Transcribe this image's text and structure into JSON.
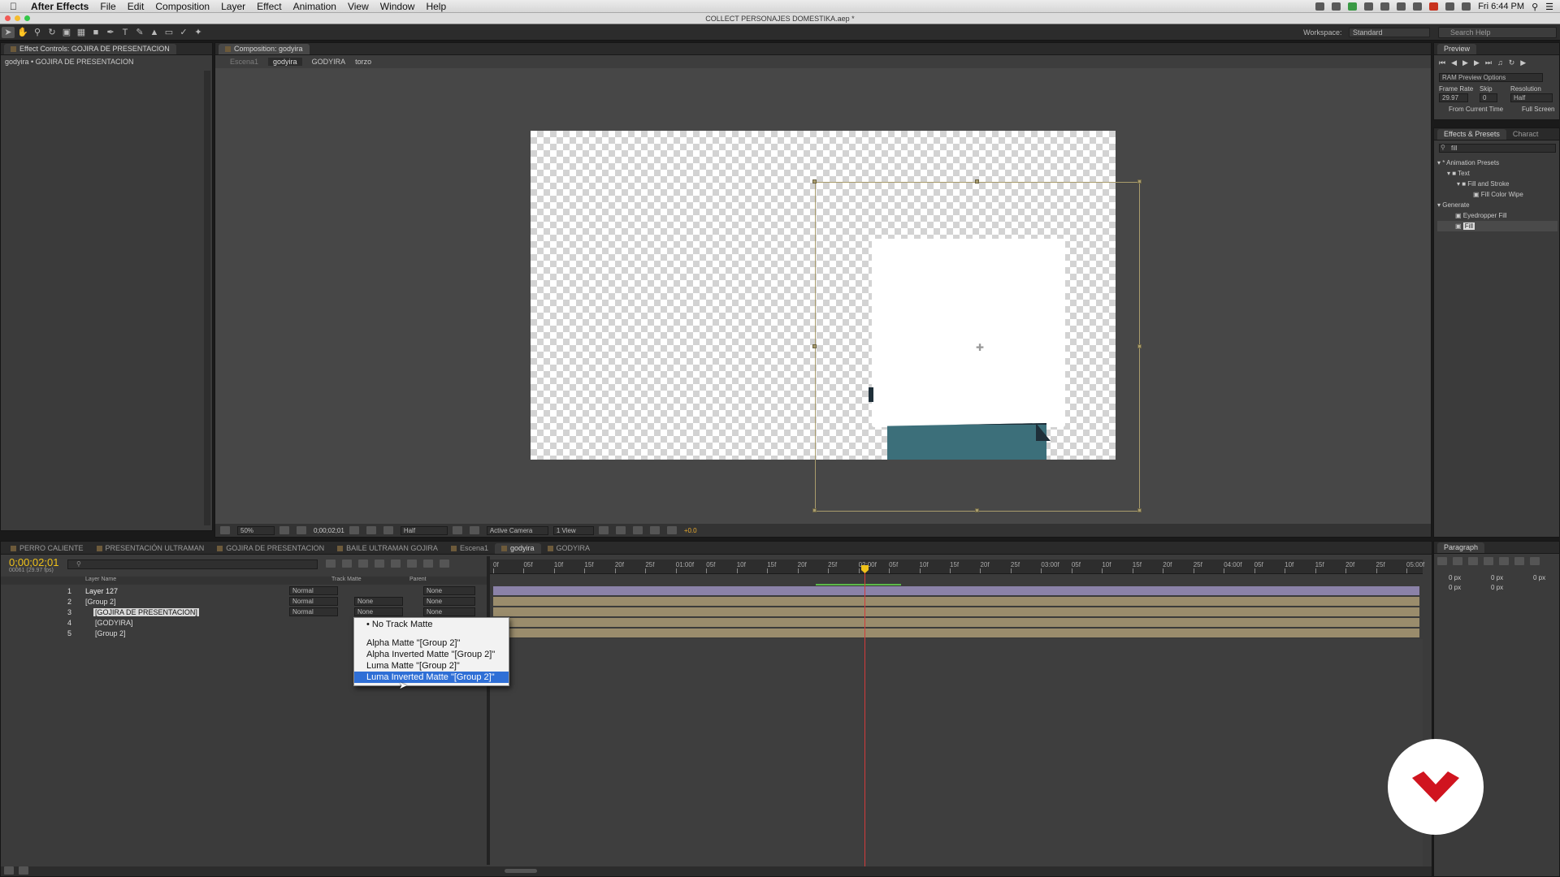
{
  "menubar": {
    "app_name": "After Effects",
    "items": [
      "File",
      "Edit",
      "Composition",
      "Layer",
      "Effect",
      "Animation",
      "View",
      "Window",
      "Help"
    ],
    "clock": "Fri 6:44 PM"
  },
  "titlebar": {
    "title": "COLLECT PERSONAJES DOMESTIKA.aep *"
  },
  "toolbar": {
    "workspace_label": "Workspace:",
    "workspace_value": "Standard",
    "search_placeholder": "Search Help"
  },
  "effect_controls": {
    "tab_label": "Effect Controls: GOJIRA DE PRESENTACION",
    "path": "godyira • GOJIRA DE PRESENTACION"
  },
  "composition": {
    "tab_label": "Composition: godyira",
    "breadcrumbs": [
      "Escena1",
      "godyira",
      "GODYIRA",
      "torzo"
    ],
    "zoom": "50%",
    "timecode": "0;00;02;01",
    "resolution": "Half",
    "camera": "Active Camera",
    "view": "1 View",
    "exposure": "+0.0"
  },
  "preview": {
    "tab_label": "Preview",
    "ram_options": "RAM Preview Options",
    "frame_rate_label": "Frame Rate",
    "skip_label": "Skip",
    "resolution_label": "Resolution",
    "frame_rate_value": "29.97",
    "skip_value": "0",
    "resolution_value": "Half",
    "from_current": "From Current Time",
    "full_screen": "Full Screen"
  },
  "effects_presets": {
    "tab_label": "Effects & Presets",
    "tab2_label": "Charact",
    "search_value": "fill",
    "tree": [
      {
        "label": "* Animation Presets",
        "level": 0
      },
      {
        "label": "Text",
        "level": 1
      },
      {
        "label": "Fill and Stroke",
        "level": 2
      },
      {
        "label": "Fill Color Wipe",
        "level": 3
      },
      {
        "label": "Generate",
        "level": 0
      },
      {
        "label": "Eyedropper Fill",
        "level": 1
      },
      {
        "label": "Fill",
        "level": 1
      }
    ]
  },
  "paragraph": {
    "tab_label": "Paragraph",
    "values": [
      "0 px",
      "0 px",
      "0 px",
      "0 px",
      "0 px"
    ]
  },
  "timeline": {
    "tabs": [
      "PERRO CALIENTE",
      "PRESENTACIÓN ULTRAMAN",
      "GOJIRA DE PRESENTACION",
      "BAILE ULTRAMAN GOJIRA",
      "Escena1",
      "godyira",
      "GODYIRA"
    ],
    "active_tab": "godyira",
    "timecode": "0;00;02;01",
    "frame_info": "00061 (29.97 fps)",
    "columns": {
      "layer_name": "Layer Name",
      "track_matte": "Track Matte",
      "parent": "Parent"
    },
    "ruler": [
      "0f",
      "05f",
      "10f",
      "15f",
      "20f",
      "25f",
      "01:00f",
      "05f",
      "10f",
      "15f",
      "20f",
      "25f",
      "02:00f",
      "05f",
      "10f",
      "15f",
      "20f",
      "25f",
      "03:00f",
      "05f",
      "10f",
      "15f",
      "20f",
      "25f",
      "04:00f",
      "05f",
      "10f",
      "15f",
      "20f",
      "25f",
      "05:00f"
    ],
    "layers": [
      {
        "num": "1",
        "name": "Layer 127",
        "mode": "Normal",
        "matte": "",
        "parent": "None"
      },
      {
        "num": "2",
        "name": "[Group 2]",
        "mode": "Normal",
        "matte": "None",
        "parent": "None"
      },
      {
        "num": "3",
        "name": "[GOJIRA DE PRESENTACION]",
        "mode": "Normal",
        "matte": "None",
        "parent": "None"
      },
      {
        "num": "4",
        "name": "[GODYIRA]",
        "mode": "",
        "matte": "",
        "parent": ""
      },
      {
        "num": "5",
        "name": "[Group 2]",
        "mode": "",
        "matte": "",
        "parent": ""
      }
    ]
  },
  "matte_menu": {
    "options": [
      "No Track Matte",
      "Alpha Matte \"[Group 2]\"",
      "Alpha Inverted Matte \"[Group 2]\"",
      "Luma Matte \"[Group 2]\"",
      "Luma Inverted Matte \"[Group 2]\""
    ],
    "selected": "Luma Inverted Matte \"[Group 2]\""
  },
  "colors": {
    "accent": "#f0c21a",
    "highlight": "#2f6fd6",
    "playhead": "#d33b3b",
    "brand": "#d0141f"
  }
}
